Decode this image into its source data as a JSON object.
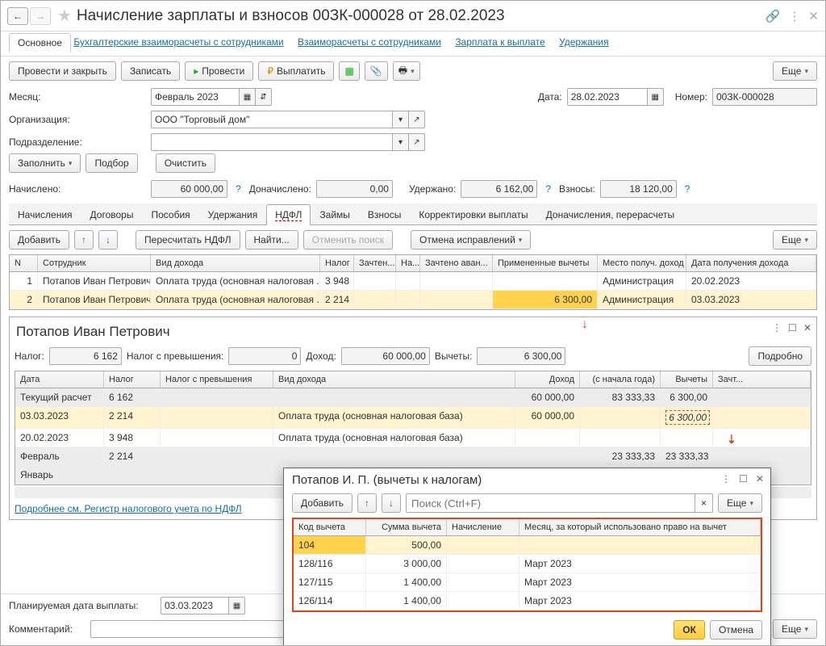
{
  "title": "Начисление зарплаты и взносов 00ЗК-000028 от 28.02.2023",
  "nav": {
    "main": "Основное",
    "links": [
      "Бухгалтерские взаиморасчеты с сотрудниками",
      "Взаиморасчеты с сотрудниками",
      "Зарплата к выплате",
      "Удержания"
    ]
  },
  "toolbar": {
    "post_close": "Провести и закрыть",
    "write": "Записать",
    "post": "Провести",
    "pay": "Выплатить",
    "more": "Еще"
  },
  "form": {
    "month_lbl": "Месяц:",
    "month": "Февраль 2023",
    "date_lbl": "Дата:",
    "date": "28.02.2023",
    "num_lbl": "Номер:",
    "num": "00ЗК-000028",
    "org_lbl": "Организация:",
    "org": "ООО \"Торговый дом\"",
    "dept_lbl": "Подразделение:",
    "dept": "",
    "fill": "Заполнить",
    "pick": "Подбор",
    "clear": "Очистить",
    "accrued_lbl": "Начислено:",
    "accrued": "60 000,00",
    "extra_lbl": "Доначислено:",
    "extra": "0,00",
    "withheld_lbl": "Удержано:",
    "withheld": "6 162,00",
    "contrib_lbl": "Взносы:",
    "contrib": "18 120,00"
  },
  "tabs": [
    "Начисления",
    "Договоры",
    "Пособия",
    "Удержания",
    "НДФЛ",
    "Займы",
    "Взносы",
    "Корректировки выплаты",
    "Доначисления, перерасчеты"
  ],
  "active_tab": 4,
  "sub": {
    "add": "Добавить",
    "recalc": "Пересчитать НДФЛ",
    "find": "Найти...",
    "cancel_search": "Отменить поиск",
    "cancel_fix": "Отмена исправлений",
    "more": "Еще"
  },
  "grid": {
    "cols": [
      "N",
      "Сотрудник",
      "Вид дохода",
      "Налог",
      "Зачтен...",
      "На...",
      "Зачтено аван...",
      "Примененные вычеты",
      "Место получ. доход",
      "Дата получения дохода"
    ],
    "rows": [
      {
        "n": "1",
        "emp": "Потапов Иван Петрович",
        "kind": "Оплата труда (основная налоговая ...",
        "tax": "3 948",
        "off": "",
        "na": "",
        "adv": "",
        "ded": "",
        "place": "Администрация",
        "date": "20.02.2023"
      },
      {
        "n": "2",
        "emp": "Потапов Иван Петрович",
        "kind": "Оплата труда (основная налоговая ...",
        "tax": "2 214",
        "off": "",
        "na": "",
        "adv": "",
        "ded": "6 300,00",
        "place": "Администрация",
        "date": "03.03.2023",
        "sel": true
      }
    ]
  },
  "detail": {
    "name": "Потапов Иван Петрович",
    "tax_lbl": "Налог:",
    "tax": "6 162",
    "over_lbl": "Налог с превышения:",
    "over": "0",
    "income_lbl": "Доход:",
    "income": "60 000,00",
    "ded_lbl": "Вычеты:",
    "ded": "6 300,00",
    "more": "Подробно",
    "cols": [
      "Дата",
      "Налог",
      "Налог с превышения",
      "Вид дохода",
      "Доход",
      "(с начала года)",
      "Вычеты",
      "Зачт..."
    ],
    "rows": [
      {
        "date": "Текущий расчет",
        "tax": "6 162",
        "over": "",
        "kind": "",
        "inc": "60 000,00",
        "ytd": "83 333,33",
        "ded": "6 300,00",
        "off": "",
        "head": true
      },
      {
        "date": "03.03.2023",
        "tax": "2 214",
        "over": "",
        "kind": "Оплата труда (основная налоговая база)",
        "inc": "60 000,00",
        "ytd": "",
        "ded": "6 300,00",
        "off": "",
        "sel": true,
        "dedmark": true
      },
      {
        "date": "20.02.2023",
        "tax": "3 948",
        "over": "",
        "kind": "Оплата труда (основная налоговая база)",
        "inc": "",
        "ytd": "",
        "ded": "",
        "off": ""
      },
      {
        "date": "Февраль",
        "tax": "2 214",
        "over": "",
        "kind": "",
        "inc": "",
        "ytd": "23 333,33",
        "ded": "23 333,33",
        "off": "",
        "head": true
      },
      {
        "date": "Январь",
        "tax": "",
        "over": "",
        "kind": "",
        "inc": "",
        "ytd": "",
        "ded": "",
        "off": "",
        "head": true
      }
    ],
    "link": "Подробнее см. Регистр налогового учета по НДФЛ"
  },
  "popup": {
    "title": "Потапов И. П. (вычеты к налогам)",
    "add": "Добавить",
    "search_ph": "Поиск (Ctrl+F)",
    "more": "Еще",
    "cols": [
      "Код вычета",
      "Сумма вычета",
      "Начисление",
      "Месяц, за который использовано право на вычет"
    ],
    "rows": [
      {
        "code": "104",
        "sum": "500,00",
        "acc": "",
        "month": "",
        "sel": true
      },
      {
        "code": "128/116",
        "sum": "3 000,00",
        "acc": "",
        "month": "Март 2023"
      },
      {
        "code": "127/115",
        "sum": "1 400,00",
        "acc": "",
        "month": "Март 2023"
      },
      {
        "code": "126/114",
        "sum": "1 400,00",
        "acc": "",
        "month": "Март 2023"
      }
    ],
    "ok": "ОК",
    "cancel": "Отмена"
  },
  "bottom": {
    "pay_date_lbl": "Планируемая дата выплаты:",
    "pay_date": "03.03.2023",
    "comment_lbl": "Комментарий:",
    "more": "Еще"
  }
}
